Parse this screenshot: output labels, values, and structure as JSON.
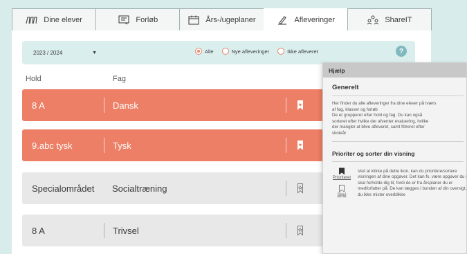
{
  "tabs": [
    {
      "label": "Dine elever",
      "icon": "students-icon",
      "active": false
    },
    {
      "label": "Forløb",
      "icon": "course-icon",
      "active": false
    },
    {
      "label": "Års-/ugeplaner",
      "icon": "calendar-icon",
      "active": false
    },
    {
      "label": "Afleveringer",
      "icon": "pencil-icon",
      "active": true
    },
    {
      "label": "ShareIT",
      "icon": "share-icon",
      "active": false
    }
  ],
  "filters": {
    "year_value": "2023 / 2024",
    "radios": [
      {
        "label": "Alle",
        "selected": true
      },
      {
        "label": "Nye afleveringer",
        "selected": false
      },
      {
        "label": "Ikke afleveret",
        "selected": false
      }
    ],
    "help_label": "?"
  },
  "columns": {
    "hold": "Hold",
    "fag": "Fag"
  },
  "rows": [
    {
      "hold": "8 A",
      "fag": "Dansk",
      "style": "orange",
      "prioritized": true
    },
    {
      "hold": "9.abc tysk",
      "fag": "Tysk",
      "style": "orange",
      "prioritized": true
    },
    {
      "hold": "Specialområdet",
      "fag": "Socialtræning",
      "style": "grey",
      "prioritized": false
    },
    {
      "hold": "8 A",
      "fag": "Trivsel",
      "style": "grey",
      "prioritized": false
    }
  ],
  "help": {
    "header": "Hjælp",
    "general_title": "Generelt",
    "general_text": "Her finder du alle afleveringer fra dine elever på tværs\naf fag, klasser og forløb\nDe er grupperet efter hold og fag. Du kan også\nsorteret efter hvilke der afventer evaluering, hvilke\nder mangler at blive afleveret, samt filtreret efter\nskoleår",
    "prio_title": "Prioriter og sorter din visning",
    "prioritized_label": "Prioriteret",
    "hide_label": "Skjul",
    "prio_text": "Ved at klikke på dette ikon, kan du prioritere/sortere visningen af dine opgaver. Det kan fx. være opgaver du ikke skal forholde dig til, fordi de er fra årsplaner du er medforfatter på. De kan lægges i bunden af din oversigt, så du ikke mister overblikke"
  },
  "colors": {
    "accent": "#ec7f66",
    "background": "#d8ecec",
    "row_grey": "#e8e8e8"
  }
}
